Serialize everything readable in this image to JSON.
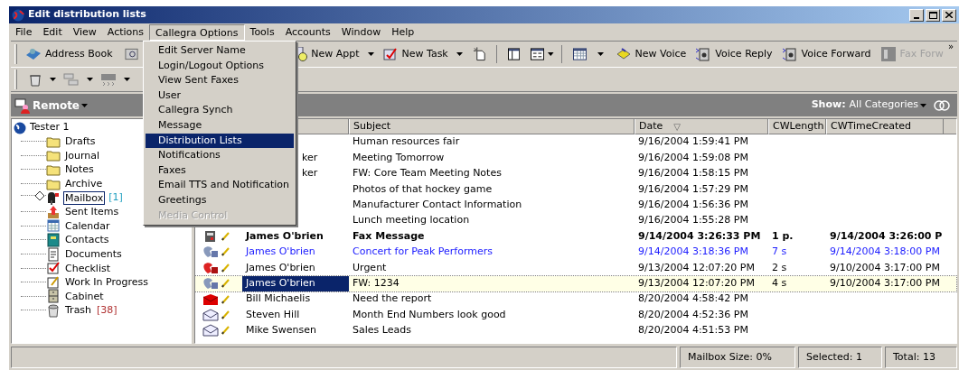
{
  "window": {
    "title": "Edit distribution lists"
  },
  "menu_bar": [
    {
      "label": "File",
      "selected": false
    },
    {
      "label": "Edit",
      "selected": false
    },
    {
      "label": "View",
      "selected": false
    },
    {
      "label": "Actions",
      "selected": false
    },
    {
      "label": "Callegra Options",
      "selected": true
    },
    {
      "label": "Tools",
      "selected": false
    },
    {
      "label": "Accounts",
      "selected": false
    },
    {
      "label": "Window",
      "selected": false
    },
    {
      "label": "Help",
      "selected": false
    }
  ],
  "dropdown": [
    {
      "label": "Edit Server Name",
      "selected": false,
      "disabled": false
    },
    {
      "label": "Login/Logout Options",
      "selected": false,
      "disabled": false
    },
    {
      "label": "View Sent Faxes",
      "selected": false,
      "disabled": false
    },
    {
      "label": "User",
      "selected": false,
      "disabled": false
    },
    {
      "label": "Callegra Synch",
      "selected": false,
      "disabled": false
    },
    {
      "label": "Message",
      "selected": false,
      "disabled": false
    },
    {
      "label": "Distribution Lists",
      "selected": true,
      "disabled": false
    },
    {
      "label": "Notifications",
      "selected": false,
      "disabled": false
    },
    {
      "label": "Faxes",
      "selected": false,
      "disabled": false
    },
    {
      "label": "Email TTS and Notification",
      "selected": false,
      "disabled": false
    },
    {
      "label": "Greetings",
      "selected": false,
      "disabled": false
    },
    {
      "label": "Media Control",
      "selected": false,
      "disabled": true
    }
  ],
  "toolbar": [
    {
      "label": "Address Book",
      "disabled": false,
      "dropdown": false
    },
    {
      "label": "New Appt",
      "disabled": false,
      "dropdown": true
    },
    {
      "label": "New Task",
      "disabled": false,
      "dropdown": true
    },
    {
      "label": "New Voice",
      "disabled": false,
      "dropdown": false
    },
    {
      "label": "Voice Reply",
      "disabled": false,
      "dropdown": false
    },
    {
      "label": "Voice Forward",
      "disabled": false,
      "dropdown": false
    },
    {
      "label": "Fax Forw",
      "disabled": true,
      "dropdown": false
    }
  ],
  "toolbar_overflow": "»",
  "folder_bar": {
    "title": "Remote",
    "show_label": "Show:",
    "show_value": "All Categories"
  },
  "tree": {
    "label": "Tester 1",
    "children": [
      {
        "label": "Drafts",
        "kind": "folder",
        "selected": false
      },
      {
        "label": "Journal",
        "kind": "folder",
        "selected": false
      },
      {
        "label": "Notes",
        "kind": "folder",
        "selected": false
      },
      {
        "label": "Archive",
        "kind": "folder",
        "selected": false
      },
      {
        "label": "Mailbox",
        "count": "[1]",
        "kind": "mailbox",
        "selected": true
      },
      {
        "label": "Sent Items",
        "kind": "sent",
        "selected": false
      },
      {
        "label": "Calendar",
        "kind": "calendar",
        "selected": false
      },
      {
        "label": "Contacts",
        "kind": "contacts",
        "selected": false
      },
      {
        "label": "Documents",
        "kind": "documents",
        "selected": false
      },
      {
        "label": "Checklist",
        "kind": "checklist",
        "selected": false
      },
      {
        "label": "Work In Progress",
        "kind": "work",
        "selected": false
      },
      {
        "label": "Cabinet",
        "kind": "cabinet",
        "selected": false
      },
      {
        "label": "Trash",
        "count": "[38]",
        "kind": "trash",
        "selected": false
      }
    ]
  },
  "table": {
    "columns": [
      "Subject",
      "Date",
      "CWLength",
      "CWTimeCreated"
    ],
    "sort_mark": "▽",
    "rows": [
      {
        "subject": "Human resources fair",
        "date": "9/16/2004 1:59:41 PM",
        "unread": false,
        "selected": false
      },
      {
        "from": "ker",
        "subject": "Meeting Tomorrow",
        "date": "9/16/2004 1:59:08 PM",
        "unread": false,
        "selected": false
      },
      {
        "from": "ker",
        "subject": "FW: Core Team Meeting Notes",
        "date": "9/16/2004 1:58:15 PM",
        "unread": false,
        "selected": false
      },
      {
        "subject": "Photos of that hockey game",
        "date": "9/16/2004 1:57:29 PM",
        "unread": false,
        "selected": false
      },
      {
        "subject": "Manufacturer Contact Information",
        "date": "9/16/2004 1:56:36 PM",
        "unread": false,
        "selected": false
      },
      {
        "subject": "Lunch meeting location",
        "date": "9/16/2004 1:55:28 PM",
        "unread": false,
        "selected": false
      },
      {
        "kind": "fax",
        "from": "James O'brien",
        "subject": "Fax Message",
        "date": "9/14/2004 3:26:33 PM",
        "length": "1 p.",
        "created": "9/14/2004 3:26:00 P",
        "unread": true,
        "selected": false
      },
      {
        "kind": "voice",
        "color": "#2020ff",
        "from": "James O'brien",
        "subject": "Concert for Peak Performers",
        "date": "9/14/2004 3:18:36 PM",
        "length": "7 s",
        "created": "9/14/2004 3:18:00 PM",
        "unread": false,
        "selected": false
      },
      {
        "kind": "urgent",
        "from": "James O'brien",
        "subject": "Urgent",
        "date": "9/13/2004 12:07:20 PM",
        "length": "2 s",
        "created": "9/10/2004 3:17:00 PM",
        "unread": false,
        "selected": false
      },
      {
        "kind": "voice",
        "from": "James O'brien",
        "subject": "FW: 1234",
        "date": "9/13/2004 12:07:20 PM",
        "length": "4 s",
        "created": "9/10/2004 3:17:00 PM",
        "unread": false,
        "selected": true
      },
      {
        "kind": "mail_closed",
        "from": "Bill Michaelis",
        "subject": "Need the report",
        "date": "8/20/2004 4:58:42 PM",
        "unread": false,
        "selected": false
      },
      {
        "kind": "mail_open",
        "from": "Steven Hill",
        "subject": "Month End Numbers look good",
        "date": "8/20/2004 4:52:36 PM",
        "unread": false,
        "selected": false
      },
      {
        "kind": "mail_open",
        "from": "Mike Swensen",
        "subject": "Sales Leads",
        "date": "8/20/2004 4:51:53 PM",
        "unread": false,
        "selected": false
      }
    ]
  },
  "status_bar": [
    "Mailbox Size: 0%",
    "Selected: 1",
    "Total: 13"
  ]
}
